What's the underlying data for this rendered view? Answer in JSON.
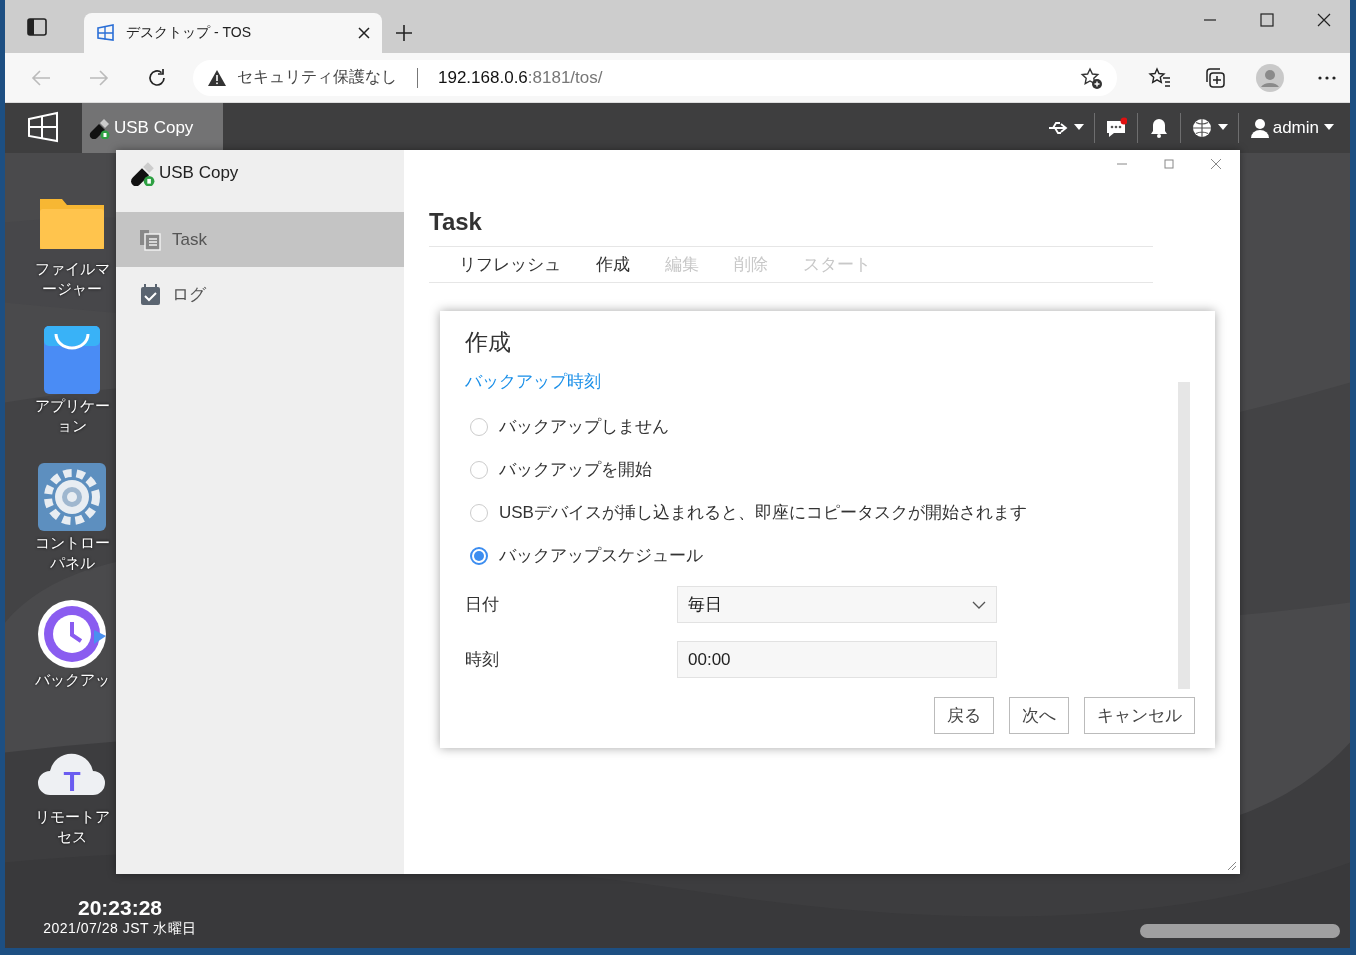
{
  "browser": {
    "tab": {
      "title": "デスクトップ - TOS"
    },
    "address": {
      "warning": "セキュリティ保護なし",
      "host": "192.168.0.6",
      "path": ":8181/tos/"
    }
  },
  "taskbar": {
    "apps": [
      {
        "label": "USB Copy",
        "selected": true
      }
    ],
    "chat_unread": true,
    "user": "admin"
  },
  "desktop_icons": [
    {
      "kind": "folder",
      "lines": [
        "ファイルマ",
        "ージャー"
      ]
    },
    {
      "kind": "store",
      "lines": [
        "アプリケー",
        "ョン"
      ]
    },
    {
      "kind": "gear",
      "lines": [
        "コントロー",
        "パネル"
      ]
    },
    {
      "kind": "backup",
      "lines": [
        "バックアッ"
      ]
    },
    {
      "kind": "cloud",
      "badge": "T",
      "lines": [
        "リモートア",
        "セス"
      ]
    }
  ],
  "window": {
    "title": "USB Copy",
    "sidebar": [
      {
        "label": "Task",
        "kind": "task",
        "selected": true
      },
      {
        "label": "ログ",
        "kind": "log",
        "selected": false
      }
    ],
    "heading": "Task",
    "toolbar": [
      {
        "label": "リフレッシュ",
        "disabled": false
      },
      {
        "label": "作成",
        "disabled": false
      },
      {
        "label": "編集",
        "disabled": true
      },
      {
        "label": "削除",
        "disabled": true
      },
      {
        "label": "スタート",
        "disabled": true
      }
    ],
    "dialog": {
      "title": "作成",
      "section": "バックアップ時刻",
      "options": [
        {
          "label": "バックアップしません",
          "selected": false
        },
        {
          "label": "バックアップを開始",
          "selected": false
        },
        {
          "label": "USBデバイスが挿し込まれると、即座にコピータスクが開始されます",
          "selected": false
        },
        {
          "label": "バックアップスケジュール",
          "selected": true
        }
      ],
      "fields": [
        {
          "kind": "select",
          "label": "日付",
          "value": "毎日"
        },
        {
          "kind": "text",
          "label": "時刻",
          "value": "00:00"
        }
      ],
      "buttons": [
        "戻る",
        "次へ",
        "キャンセル"
      ]
    }
  },
  "clock": {
    "time": "20:23:28",
    "date": "2021/07/28 JST 水曜日"
  }
}
